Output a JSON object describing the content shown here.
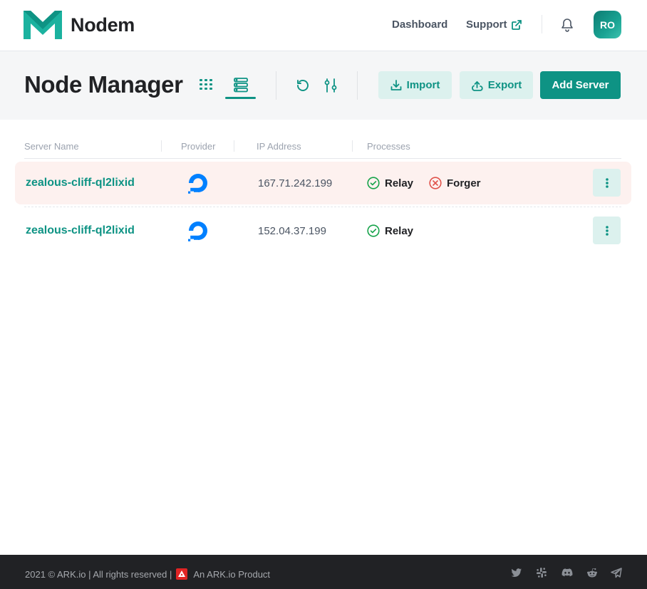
{
  "nav": {
    "brand": "Nodem",
    "dashboard_label": "Dashboard",
    "support_label": "Support",
    "avatar_initials": "RO"
  },
  "header": {
    "title": "Node Manager",
    "import_label": "Import",
    "export_label": "Export",
    "add_server_label": "Add Server",
    "active_view": "list"
  },
  "table": {
    "columns": [
      "Server Name",
      "Provider",
      "IP Address",
      "Processes"
    ],
    "rows": [
      {
        "name": "zealous-cliff-ql2lixid",
        "provider": "digitalocean-icon",
        "ip": "167.71.242.199",
        "processes": [
          {
            "label": "Relay",
            "status": "running"
          },
          {
            "label": "Forger",
            "status": "error"
          }
        ],
        "highlighted": true
      },
      {
        "name": "zealous-cliff-ql2lixid",
        "provider": "digitalocean-icon",
        "ip": "152.04.37.199",
        "processes": [
          {
            "label": "Relay",
            "status": "running"
          }
        ],
        "highlighted": false
      }
    ]
  },
  "footer": {
    "copyright": "2021 © ARK.io | All rights reserved |",
    "product": "An ARK.io Product",
    "social_icons": [
      "twitter-icon",
      "slack-icon",
      "discord-icon",
      "reddit-icon",
      "telegram-icon"
    ]
  },
  "colors": {
    "accent": "#0e9384",
    "accent_light": "#dcf1ee",
    "row_highlight": "#fdf1ef",
    "error": "#e0524a",
    "footer_bg": "#212225"
  }
}
